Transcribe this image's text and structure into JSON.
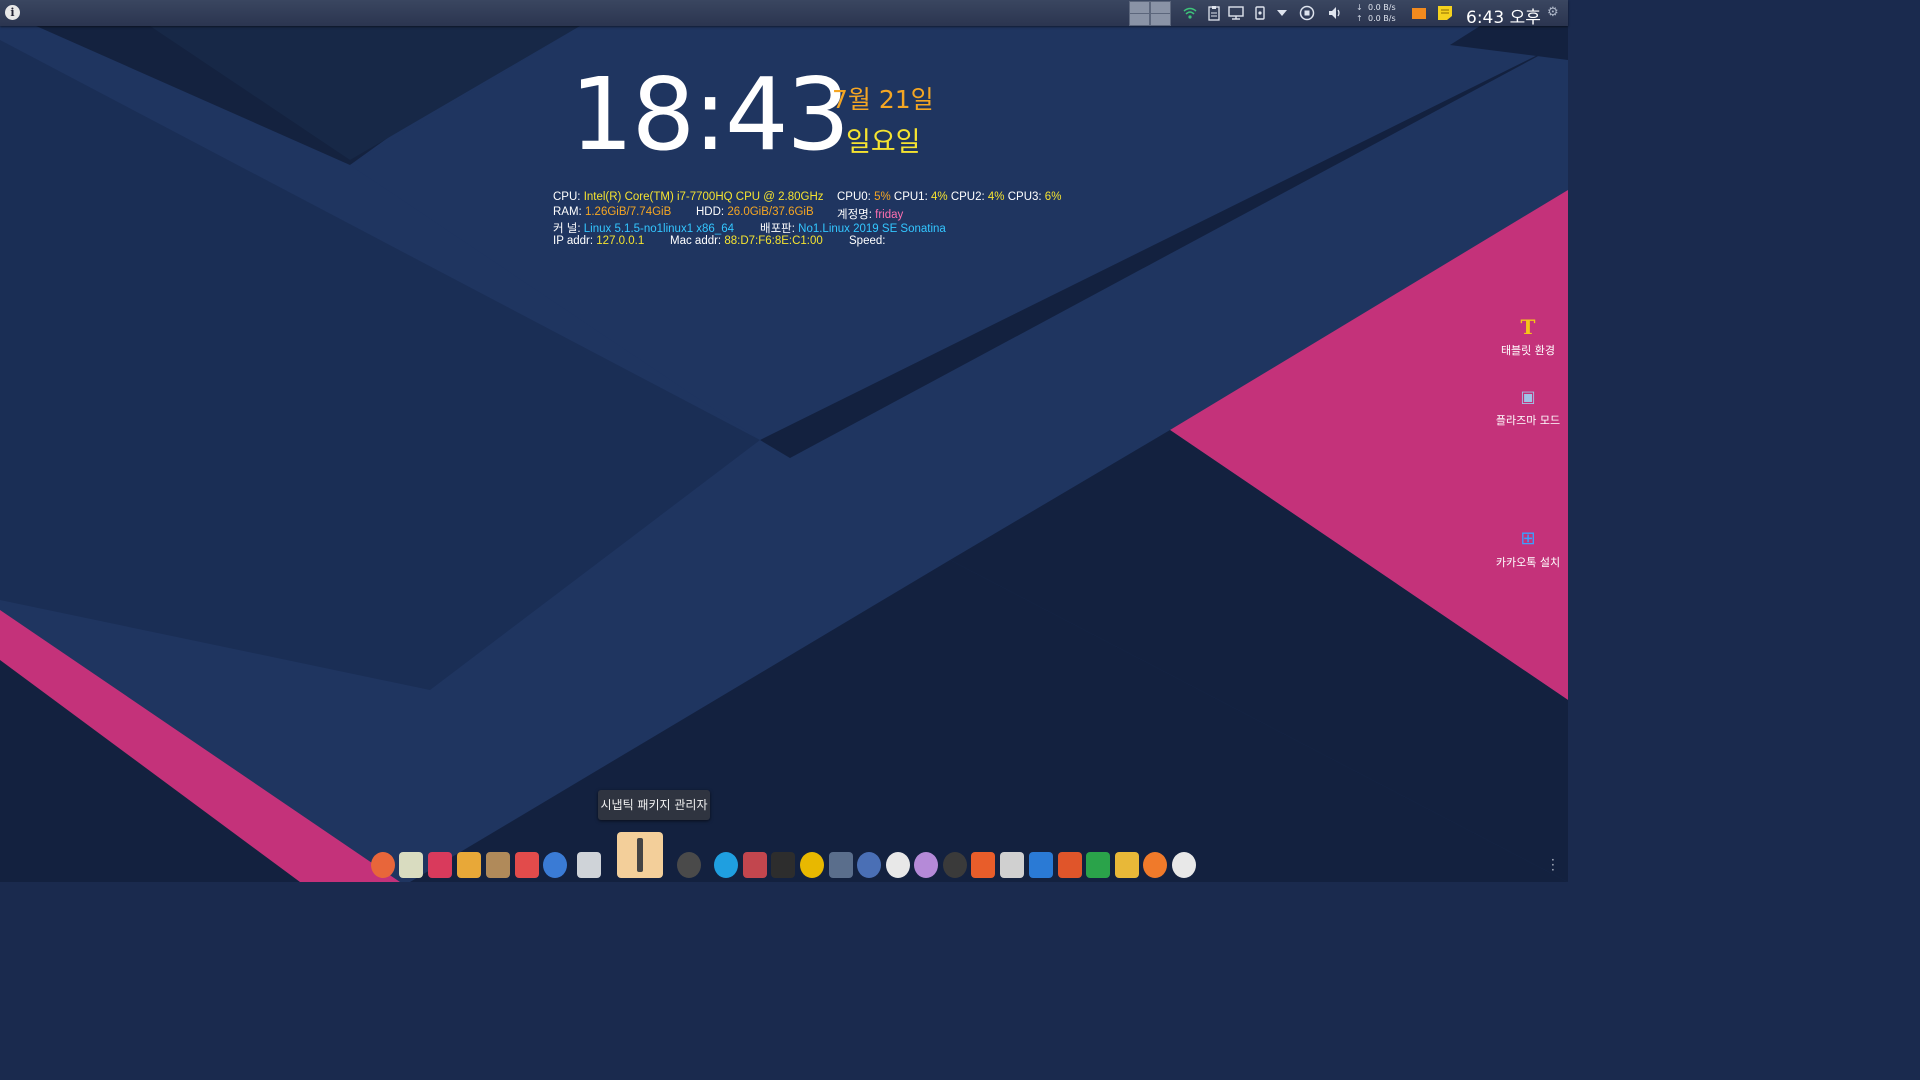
{
  "panel": {
    "info_label": "i",
    "net_down": "0.0 B/s",
    "net_up": "0.0 B/s",
    "clock": "6:43 오후",
    "tray_icons": [
      "wifi-icon",
      "clipboard-icon",
      "display-icon",
      "device-icon",
      "chevron-down-icon",
      "record-icon",
      "volume-icon",
      "orange-app-icon",
      "notes-icon"
    ],
    "settings_icon": "gear-icon"
  },
  "clock_widget": {
    "time": "18:43",
    "date": "7월 21일",
    "weekday": "일요일"
  },
  "sysinfo": {
    "cpu_label": "CPU:",
    "cpu_model": "Intel(R) Core(TM) i7-7700HQ CPU @ 2.80GHz",
    "cpu0_label": "CPU0:",
    "cpu0": "5%",
    "cpu1_label": "CPU1:",
    "cpu1": "4%",
    "cpu2_label": "CPU2:",
    "cpu2": "4%",
    "cpu3_label": "CPU3:",
    "cpu3": "6%",
    "ram_label": "RAM:",
    "ram": "1.26GiB/7.74GiB",
    "hdd_label": "HDD:",
    "hdd": "26.0GiB/37.6GiB",
    "account_label": "계정명:",
    "account": "friday",
    "kernel_label": "커 널:",
    "kernel": "Linux 5.1.5-no1linux1 x86_64",
    "distro_label": "배포판:",
    "distro": "No1.Linux 2019 SE Sonatina",
    "ip_label": "IP addr:",
    "ip": "127.0.0.1",
    "mac_label": "Mac addr:",
    "mac": "88:D7:F6:8E:C1:00",
    "speed_label": "Speed:"
  },
  "desktop_icons": [
    {
      "label": "태블릿 환경",
      "glyph": "T",
      "icon": "tablet-mode-icon"
    },
    {
      "label": "플라즈마 모드",
      "glyph": "▣",
      "icon": "plasma-mode-icon"
    },
    {
      "label": "카카오톡 설치",
      "glyph": "⊞",
      "icon": "kakaotalk-install-icon"
    }
  ],
  "tooltip": "시냅틱 패키지 관리자",
  "dock": {
    "items": [
      {
        "name": "firefox-icon",
        "color": "#e8663a"
      },
      {
        "name": "file-manager-icon",
        "color": "#d9dcc0"
      },
      {
        "name": "app-grid-icon",
        "color": "#d93a5c"
      },
      {
        "name": "mixer-icon",
        "color": "#e8a838"
      },
      {
        "name": "paint-brush-icon",
        "color": "#b08a5a"
      },
      {
        "name": "id-card-icon",
        "color": "#e24b4b"
      },
      {
        "name": "qbittorrent-icon",
        "color": "#3a7bd5"
      },
      {
        "name": "document-viewer-icon",
        "color": "#cfd3d8"
      },
      {
        "name": "synaptic-package-manager-icon",
        "color": "#f3cf9a"
      },
      {
        "name": "amazon-icon",
        "color": "#4a4a4a"
      },
      {
        "name": "kodi-icon",
        "color": "#1f9fe0"
      },
      {
        "name": "screen-recorder-icon",
        "color": "#c2464e"
      },
      {
        "name": "terminal-icon",
        "color": "#2d2d2d"
      },
      {
        "name": "music-player-icon",
        "color": "#e8b800"
      },
      {
        "name": "spreadsheet-tool-icon",
        "color": "#5a6e8c"
      },
      {
        "name": "r-language-icon",
        "color": "#4a6fb5"
      },
      {
        "name": "eye-icon",
        "color": "#e8e8e8"
      },
      {
        "name": "planet-icon",
        "color": "#b58ad8"
      },
      {
        "name": "palette-icon",
        "color": "#3a3a3a"
      },
      {
        "name": "xpdf-icon",
        "color": "#e85d2a"
      },
      {
        "name": "no-entry-document-icon",
        "color": "#d0d0d0"
      },
      {
        "name": "writer-icon",
        "color": "#2a7ad5"
      },
      {
        "name": "impress-icon",
        "color": "#e0552a"
      },
      {
        "name": "calc-icon",
        "color": "#2aa34a"
      },
      {
        "name": "draw-icon",
        "color": "#e8b838"
      },
      {
        "name": "firefox-alt-icon",
        "color": "#f07a2a"
      },
      {
        "name": "clock-app-icon",
        "color": "#e8e8e8"
      }
    ],
    "more_icon": "more-vertical-icon"
  },
  "colors": {
    "wallpaper_base": "#1f3560",
    "wallpaper_dark": "#13213f",
    "accent_pink": "#c4327a",
    "clock_date": "#f5a623",
    "clock_weekday": "#f5e330"
  }
}
